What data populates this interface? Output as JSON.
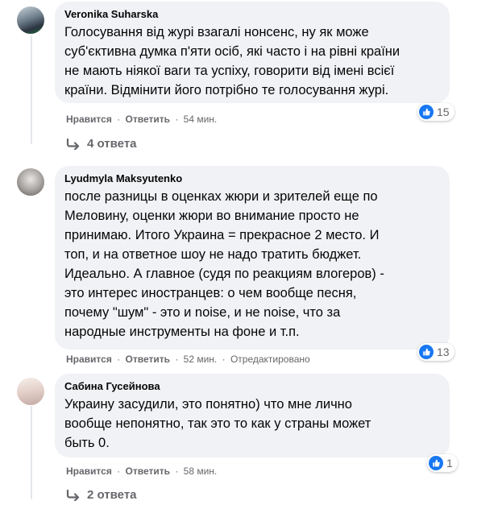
{
  "comments": [
    {
      "author": "Veronika Suharska",
      "text": "Голосування від журі взагалі нонсенс, ну як може\nсуб'єктивна думка п'яти осіб, які часто і на рівні країни\nне мають ніякої ваги та успіху, говорити від імені всієї\nкраїни. Відмінити його потрібно те голосування журі.",
      "like_label": "Нравится",
      "reply_label": "Ответить",
      "time": "54 мин.",
      "edited": "",
      "reaction_count": "15",
      "replies_label": "4 ответа"
    },
    {
      "author": "Lyudmyla Maksyutenko",
      "text": "после разницы в оценках жюри и зрителей еще по\nМеловину, оценки жюри во внимание просто не\nпринимаю. Итого Украина = прекрасное 2 место. И\nтоп, и на ответное шоу не надо тратить бюджет.\nИдеально. А главное (судя по реакциям влогеров) -\nэто интерес иностранцев: о чем вообще песня,\nпочему \"шум\" - это и noise, и не noise, что за\nнародные инструменты на фоне и т.п.",
      "like_label": "Нравится",
      "reply_label": "Ответить",
      "time": "52 мин.",
      "edited": "Отредактировано",
      "reaction_count": "13",
      "replies_label": ""
    },
    {
      "author": "Сабина Гусейнова",
      "text": "Украину засудили, это понятно) что мне лично\nвообще непонятно, так это то как у страны может\nбыть 0.",
      "like_label": "Нравится",
      "reply_label": "Ответить",
      "time": "58 мин.",
      "edited": "",
      "reaction_count": "1",
      "replies_label": "2 ответа"
    }
  ],
  "separator": "·",
  "colors": {
    "bubble": "#f0f2f5",
    "meta": "#65676b",
    "like_blue": "#1877f2"
  },
  "icons": {
    "like": "thumbs-up-icon",
    "reply_arrow": "reply-arrow-icon"
  }
}
